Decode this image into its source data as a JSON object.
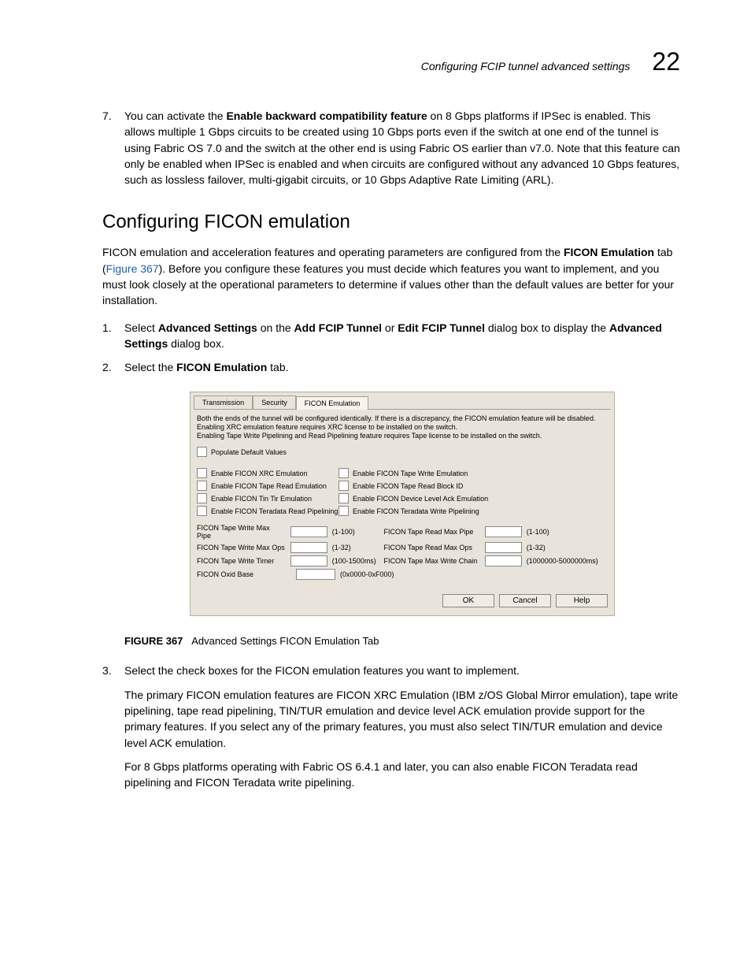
{
  "header": {
    "title": "Configuring FCIP tunnel advanced settings",
    "chapter": "22"
  },
  "item7": {
    "marker": "7.",
    "pre": "You can activate the ",
    "bold": "Enable backward compatibility feature",
    "post": " on 8 Gbps platforms if IPSec is enabled. This allows multiple 1 Gbps circuits to be created using 10 Gbps ports even if the switch at one end of the tunnel is using Fabric OS 7.0 and the switch at the other end is using Fabric OS earlier than v7.0. Note that this feature can only be enabled when IPSec is enabled and when circuits are configured without any advanced 10 Gbps features, such as lossless failover, multi-gigabit circuits, or 10 Gbps Adaptive Rate Limiting (ARL)."
  },
  "section_heading": "Configuring FICON emulation",
  "intro": {
    "pre": "FICON emulation and acceleration features and operating parameters are configured from the ",
    "bold": "FICON Emulation",
    "mid": " tab (",
    "ref": "Figure 367",
    "post": "). Before you configure these features you must decide which features you want to implement, and you must look closely at the operational parameters to determine if values other than the default values are better for your installation."
  },
  "step1": {
    "marker": "1.",
    "t1": "Select ",
    "b1": "Advanced Settings",
    "t2": " on the ",
    "b2": "Add FCIP Tunnel",
    "t3": " or ",
    "b3": "Edit FCIP Tunnel",
    "t4": " dialog box to display the ",
    "b4": "Advanced Settings",
    "t5": " dialog box."
  },
  "step2": {
    "marker": "2.",
    "t1": "Select the ",
    "b1": "FICON Emulation",
    "t2": " tab."
  },
  "dialog": {
    "tabs": {
      "t1": "Transmission",
      "t2": "Security",
      "t3": "FICON Emulation"
    },
    "note_l1": "Both the ends of the tunnel will be configured identically. If there is a discrepancy, the FICON emulation feature will be disabled.",
    "note_l2": "Enabling XRC emulation feature requires XRC license to be installed on the switch.",
    "note_l3": "Enabling Tape Write Pipelining and Read Pipelining feature requires Tape license to be installed on the switch.",
    "populate": "Populate Default Values",
    "cb": {
      "xrc": "Enable FICON XRC Emulation",
      "tape_write_emu": "Enable FICON Tape Write Emulation",
      "tape_read_emu": "Enable FICON Tape Read Emulation",
      "tape_read_block": "Enable FICON Tape Read Block ID",
      "tin_tir": "Enable FICON Tin Tir Emulation",
      "dev_ack": "Enable FICON Device Level Ack Emulation",
      "teradata_read": "Enable FICON Teradata Read Pipelining",
      "teradata_write": "Enable FICON Teradata Write Pipelining"
    },
    "in": {
      "tw_max_pipe": "FICON Tape Write Max Pipe",
      "tw_max_pipe_hint": "(1-100)",
      "tr_max_pipe": "FICON Tape Read Max Pipe",
      "tr_max_pipe_hint": "(1-100)",
      "tw_max_ops": "FICON Tape Write Max Ops",
      "tw_max_ops_hint": "(1-32)",
      "tr_max_ops": "FICON Tape Read Max Ops",
      "tr_max_ops_hint": "(1-32)",
      "tw_timer": "FICON Tape Write Timer",
      "tw_timer_hint": "(100-1500ms)",
      "tmax_write_chain": "FICON Tape Max Write Chain",
      "tmax_write_chain_hint": "(1000000-5000000ms)",
      "oxid": "FICON Oxid Base",
      "oxid_hint": "(0x0000-0xF000)"
    },
    "buttons": {
      "ok": "OK",
      "cancel": "Cancel",
      "help": "Help"
    }
  },
  "figure_caption": {
    "lead": "FIGURE 367",
    "rest": "Advanced Settings FICON Emulation Tab"
  },
  "step3": {
    "marker": "3.",
    "line1": "Select the check boxes for the FICON emulation features you want to implement.",
    "line2": "The primary FICON emulation features are FICON XRC Emulation (IBM z/OS Global Mirror emulation), tape write pipelining, tape read pipelining, TIN/TUR emulation and device level ACK emulation provide support for the primary features. If you select any of the primary features, you must also select TIN/TUR emulation and device level ACK emulation.",
    "line3": "For 8 Gbps platforms operating with Fabric OS 6.4.1 and later, you can also enable FICON Teradata read pipelining and FICON Teradata write pipelining."
  }
}
